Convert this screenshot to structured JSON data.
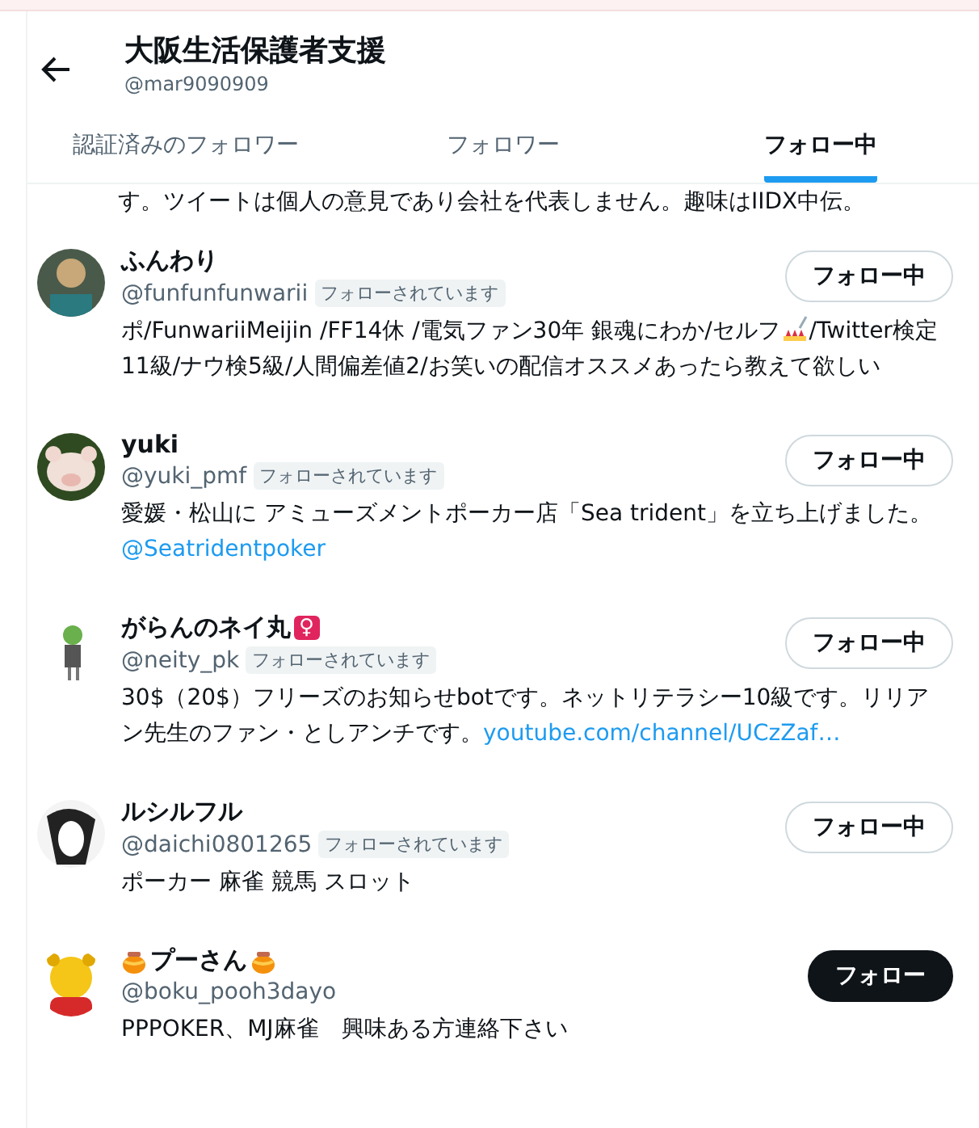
{
  "header": {
    "title": "大阪生活保護者支援",
    "handle": "@mar9090909"
  },
  "tabs": [
    {
      "label": "認証済みのフォロワー",
      "selected": false
    },
    {
      "label": "フォロワー",
      "selected": false
    },
    {
      "label": "フォロー中",
      "selected": true
    }
  ],
  "cut_bio": "す。ツイートは個人の意見であり会社を代表しません。趣味はIIDX中伝。",
  "users": [
    {
      "name": [
        {
          "kind": "text",
          "text": "ふんわり"
        }
      ],
      "handle": "@funfunfunwarii",
      "follows_you": "フォローされています",
      "button": "フォロー中",
      "following": true,
      "bio": [
        {
          "kind": "text",
          "text": "ポ/FunwariiMeijin /FF14休 /電気ファン30年 銀魂にわか/セルフ"
        },
        {
          "kind": "icon"
        },
        {
          "kind": "text",
          "text": "/Twitter検定11級/ナウ検5級/人間偏差値2/お笑いの配信オススメあったら教えて欲しい"
        }
      ]
    },
    {
      "name": [
        {
          "kind": "text",
          "text": "yuki"
        }
      ],
      "handle": "@yuki_pmf",
      "follows_you": "フォローされています",
      "button": "フォロー中",
      "following": true,
      "bio": [
        {
          "kind": "text",
          "text": "愛媛・松山に アミューズメントポーカー店「Sea trident」を立ち上げました。"
        },
        {
          "kind": "link",
          "text": "@Seatridentpoker"
        }
      ]
    },
    {
      "name": [
        {
          "kind": "text",
          "text": "がらんのネイ丸"
        },
        {
          "kind": "badge",
          "text": "♀"
        }
      ],
      "handle": "@neity_pk",
      "follows_you": "フォローされています",
      "button": "フォロー中",
      "following": true,
      "bio": [
        {
          "kind": "text",
          "text": "30$（20$）フリーズのお知らせbotです。ネットリテラシー10級です。リリアン先生のファン・としアンチです。"
        },
        {
          "kind": "link",
          "text": "youtube.com/channel/UCzZaf…"
        }
      ]
    },
    {
      "name": [
        {
          "kind": "text",
          "text": "ルシルフル"
        }
      ],
      "handle": "@daichi0801265",
      "follows_you": "フォローされています",
      "button": "フォロー中",
      "following": true,
      "bio": [
        {
          "kind": "text",
          "text": "ポーカー 麻雀 競馬 スロット"
        }
      ]
    },
    {
      "name": [
        {
          "kind": "icon"
        },
        {
          "kind": "text",
          "text": "プーさん"
        },
        {
          "kind": "icon"
        }
      ],
      "handle": "@boku_pooh3dayo",
      "button": "フォロー",
      "following": false,
      "bio": [
        {
          "kind": "text",
          "text": "PPPOKER、MJ麻雀　興味ある方連絡下さい"
        }
      ]
    }
  ]
}
